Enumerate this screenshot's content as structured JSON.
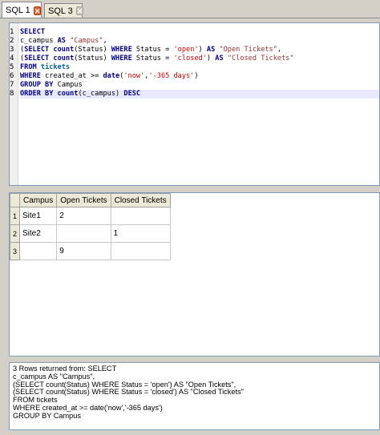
{
  "tabs": [
    {
      "label": "SQL 1",
      "close_icon": "close-icon",
      "active": true
    },
    {
      "label": "SQL 3",
      "close_icon": "close-icon",
      "active": false
    }
  ],
  "editor": {
    "line_numbers": [
      "1",
      "2",
      "3",
      "4",
      "5",
      "6",
      "7",
      "8"
    ],
    "lines": [
      [
        {
          "t": "SELECT",
          "c": "kw"
        }
      ],
      [
        {
          "t": "c_campus ",
          "c": ""
        },
        {
          "t": "AS",
          "c": "kw"
        },
        {
          "t": " ",
          "c": ""
        },
        {
          "t": "\"Campus\"",
          "c": "strq"
        },
        {
          "t": ",",
          "c": ""
        }
      ],
      [
        {
          "t": "(",
          "c": ""
        },
        {
          "t": "SELECT",
          "c": "kw"
        },
        {
          "t": " ",
          "c": ""
        },
        {
          "t": "count",
          "c": "fn"
        },
        {
          "t": "(Status) ",
          "c": ""
        },
        {
          "t": "WHERE",
          "c": "kw"
        },
        {
          "t": " Status = ",
          "c": ""
        },
        {
          "t": "'open'",
          "c": "str"
        },
        {
          "t": ") ",
          "c": ""
        },
        {
          "t": "AS",
          "c": "kw"
        },
        {
          "t": " ",
          "c": ""
        },
        {
          "t": "\"Open Tickets\"",
          "c": "strq"
        },
        {
          "t": ",",
          "c": ""
        }
      ],
      [
        {
          "t": "(",
          "c": ""
        },
        {
          "t": "SELECT",
          "c": "kw"
        },
        {
          "t": " ",
          "c": ""
        },
        {
          "t": "count",
          "c": "fn"
        },
        {
          "t": "(Status) ",
          "c": ""
        },
        {
          "t": "WHERE",
          "c": "kw"
        },
        {
          "t": " Status = ",
          "c": ""
        },
        {
          "t": "'closed'",
          "c": "str"
        },
        {
          "t": ") ",
          "c": ""
        },
        {
          "t": "AS",
          "c": "kw"
        },
        {
          "t": " ",
          "c": ""
        },
        {
          "t": "\"Closed Tickets\"",
          "c": "strq"
        }
      ],
      [
        {
          "t": "FROM",
          "c": "kw"
        },
        {
          "t": " ",
          "c": ""
        },
        {
          "t": "tickets",
          "c": "tbl"
        }
      ],
      [
        {
          "t": "WHERE",
          "c": "kw"
        },
        {
          "t": " created_at >= ",
          "c": ""
        },
        {
          "t": "date",
          "c": "fn"
        },
        {
          "t": "(",
          "c": ""
        },
        {
          "t": "'now'",
          "c": "str"
        },
        {
          "t": ",",
          "c": ""
        },
        {
          "t": "'-365 days'",
          "c": "str"
        },
        {
          "t": ")",
          "c": ""
        }
      ],
      [
        {
          "t": "GROUP BY",
          "c": "kw"
        },
        {
          "t": " Campus",
          "c": ""
        }
      ],
      [
        {
          "t": "ORDER BY",
          "c": "kw"
        },
        {
          "t": " ",
          "c": ""
        },
        {
          "t": "count",
          "c": "fn"
        },
        {
          "t": "(c_campus) ",
          "c": ""
        },
        {
          "t": "DESC",
          "c": "kw"
        }
      ]
    ],
    "current_line": 8
  },
  "results": {
    "columns": [
      "Campus",
      "Open Tickets",
      "Closed Tickets"
    ],
    "rows": [
      {
        "num": "1",
        "cells": [
          "Site1",
          "2",
          ""
        ]
      },
      {
        "num": "2",
        "cells": [
          "Site2",
          "",
          "1"
        ]
      },
      {
        "num": "3",
        "cells": [
          "",
          "9",
          ""
        ]
      }
    ]
  },
  "message": {
    "text": "3 Rows returned from: SELECT\nc_campus AS \"Campus\",\n(SELECT count(Status) WHERE Status = 'open') AS \"Open Tickets\",\n(SELECT count(Status) WHERE Status = 'closed') AS \"Closed Tickets\"\nFROM tickets\nWHERE created_at >= date('now','-365 days')\nGROUP BY Campus"
  },
  "colors": {
    "keyword": "#00008b",
    "string": "#cc0000",
    "table_name": "#006699",
    "tab_close_active": "#e2602a",
    "panel_border": "#7f9db9",
    "chrome": "#d4d0c8"
  }
}
